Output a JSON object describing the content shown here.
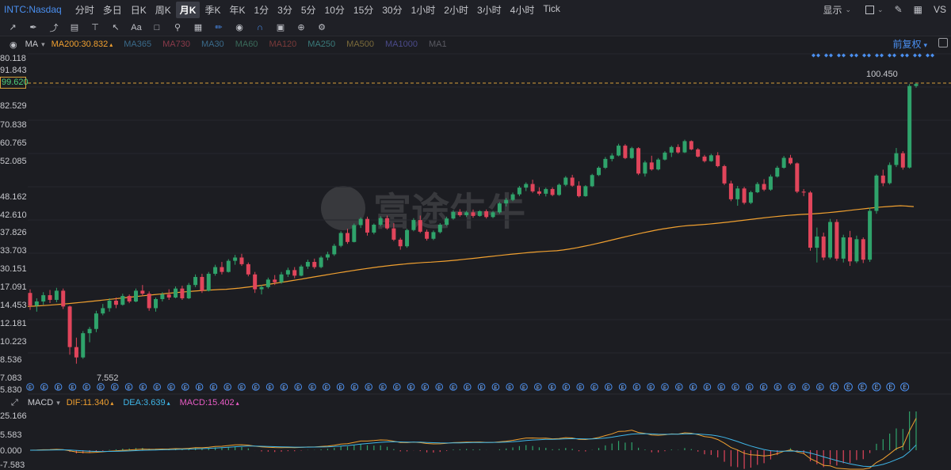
{
  "symbol": "INTC:Nasdaq",
  "periods": [
    "分时",
    "多日",
    "日K",
    "周K",
    "月K",
    "季K",
    "年K",
    "1分",
    "3分",
    "5分",
    "10分",
    "15分",
    "30分",
    "1小时",
    "2小时",
    "3小时",
    "4小时",
    "Tick"
  ],
  "active_period": "月K",
  "top_right": {
    "display": "显示",
    "logo": "VS"
  },
  "indicator": {
    "name": "MA",
    "ma200": "MA200:30.832",
    "dim_items": [
      "MA365",
      "MA730",
      "MA30",
      "MA60",
      "MA120",
      "MA250",
      "MA500",
      "MA1000",
      "MA1"
    ],
    "adjust": "前复权"
  },
  "y_axis_labels": [
    "80.118",
    "91.843",
    "99.620",
    "82.529",
    "70.838",
    "60.765",
    "52.085",
    "48.162",
    "42.610",
    "37.826",
    "33.703",
    "30.151",
    "17.091",
    "14.453",
    "12.181",
    "10.223",
    "8.536",
    "7.083",
    "5.830"
  ],
  "cursor_value": "99.620",
  "high_label": "100.450",
  "low_label": "7.552",
  "macd": {
    "name": "MACD",
    "dif": "DIF:11.340",
    "dea": "DEA:3.639",
    "macd": "MACD:15.402"
  },
  "macd_axis_labels": [
    "25.166",
    "5.583",
    "0.000",
    "-7.583"
  ],
  "watermark": "富途牛牛",
  "colors": {
    "up": "#2fa36b",
    "down": "#e1455b",
    "ma200": "#f0a030",
    "dif": "#f0a030",
    "dea": "#3fb6e8",
    "macd": "#e85bc5",
    "accent": "#4a8ff0"
  },
  "chart_data": {
    "type": "candlestick",
    "title": "INTC:Nasdaq",
    "ma_line": "MA200",
    "candles": [
      [
        14.5,
        15.0,
        12.4,
        12.9
      ],
      [
        12.9,
        13.8,
        12.2,
        13.4
      ],
      [
        13.4,
        14.6,
        13.0,
        14.2
      ],
      [
        14.2,
        14.9,
        13.2,
        13.6
      ],
      [
        13.6,
        15.2,
        13.3,
        14.8
      ],
      [
        14.8,
        15.1,
        12.5,
        12.8
      ],
      [
        12.8,
        12.9,
        8.2,
        8.8
      ],
      [
        8.8,
        9.6,
        7.55,
        8.0
      ],
      [
        8.0,
        10.2,
        7.9,
        10.0
      ],
      [
        10.0,
        10.6,
        9.2,
        10.4
      ],
      [
        10.4,
        12.3,
        10.1,
        12.0
      ],
      [
        12.0,
        13.1,
        11.8,
        12.6
      ],
      [
        12.6,
        13.8,
        12.2,
        13.5
      ],
      [
        13.5,
        13.9,
        12.6,
        13.0
      ],
      [
        13.0,
        14.4,
        12.9,
        14.1
      ],
      [
        14.1,
        14.3,
        13.2,
        13.4
      ],
      [
        13.4,
        15.1,
        13.3,
        14.8
      ],
      [
        14.8,
        15.6,
        14.1,
        14.4
      ],
      [
        14.4,
        14.7,
        12.3,
        12.6
      ],
      [
        12.6,
        13.9,
        12.2,
        13.7
      ],
      [
        13.7,
        14.6,
        13.4,
        14.3
      ],
      [
        14.3,
        15.0,
        13.6,
        13.9
      ],
      [
        13.9,
        15.4,
        13.8,
        15.1
      ],
      [
        15.1,
        15.5,
        13.6,
        13.8
      ],
      [
        13.8,
        15.9,
        13.7,
        15.6
      ],
      [
        15.6,
        17.2,
        15.3,
        16.8
      ],
      [
        16.8,
        17.3,
        14.5,
        14.8
      ],
      [
        14.8,
        17.6,
        14.7,
        17.3
      ],
      [
        17.3,
        18.8,
        17.0,
        18.4
      ],
      [
        18.4,
        19.3,
        17.2,
        17.6
      ],
      [
        17.6,
        19.8,
        17.5,
        19.5
      ],
      [
        19.5,
        20.6,
        18.8,
        20.1
      ],
      [
        20.1,
        20.8,
        18.6,
        18.9
      ],
      [
        18.9,
        19.2,
        16.9,
        17.2
      ],
      [
        17.2,
        17.6,
        14.5,
        15.0
      ],
      [
        15.0,
        15.6,
        14.3,
        15.3
      ],
      [
        15.3,
        16.7,
        15.1,
        16.4
      ],
      [
        16.4,
        17.1,
        15.6,
        16.0
      ],
      [
        16.0,
        17.6,
        15.8,
        17.2
      ],
      [
        17.2,
        18.3,
        16.8,
        17.9
      ],
      [
        17.9,
        18.4,
        16.6,
        17.0
      ],
      [
        17.0,
        18.8,
        16.9,
        18.5
      ],
      [
        18.5,
        19.7,
        18.1,
        19.3
      ],
      [
        19.3,
        19.9,
        18.1,
        18.4
      ],
      [
        18.4,
        20.4,
        18.2,
        20.1
      ],
      [
        20.1,
        21.2,
        19.6,
        20.7
      ],
      [
        20.7,
        22.8,
        20.4,
        22.4
      ],
      [
        22.4,
        25.6,
        22.1,
        25.2
      ],
      [
        25.2,
        26.2,
        22.8,
        23.2
      ],
      [
        23.2,
        27.5,
        23.1,
        27.1
      ],
      [
        27.1,
        29.1,
        26.4,
        28.7
      ],
      [
        28.7,
        29.3,
        24.6,
        25.3
      ],
      [
        25.3,
        27.5,
        24.9,
        27.2
      ],
      [
        27.2,
        29.4,
        26.8,
        28.9
      ],
      [
        28.9,
        29.6,
        26.0,
        26.3
      ],
      [
        26.3,
        27.6,
        23.4,
        23.7
      ],
      [
        23.7,
        24.1,
        21.6,
        22.3
      ],
      [
        22.3,
        26.2,
        22.0,
        25.9
      ],
      [
        25.9,
        28.9,
        25.6,
        28.4
      ],
      [
        28.4,
        29.6,
        25.2,
        25.5
      ],
      [
        25.5,
        26.0,
        23.5,
        23.9
      ],
      [
        23.9,
        25.8,
        23.6,
        25.4
      ],
      [
        25.4,
        27.6,
        25.1,
        27.2
      ],
      [
        27.2,
        29.3,
        26.9,
        28.8
      ],
      [
        28.8,
        31.1,
        28.5,
        30.6
      ],
      [
        30.6,
        31.4,
        29.3,
        29.7
      ],
      [
        29.7,
        30.9,
        29.2,
        30.5
      ],
      [
        30.5,
        31.3,
        29.0,
        29.5
      ],
      [
        29.5,
        31.1,
        29.3,
        30.8
      ],
      [
        30.8,
        31.3,
        28.8,
        29.2
      ],
      [
        29.2,
        30.9,
        28.9,
        30.5
      ],
      [
        30.5,
        33.5,
        30.1,
        33.1
      ],
      [
        33.1,
        34.8,
        32.2,
        34.2
      ],
      [
        34.2,
        36.6,
        33.8,
        36.0
      ],
      [
        36.0,
        38.9,
        35.4,
        38.3
      ],
      [
        38.3,
        40.2,
        37.1,
        39.6
      ],
      [
        39.6,
        41.2,
        36.5,
        37.0
      ],
      [
        37.0,
        38.4,
        35.6,
        36.2
      ],
      [
        36.2,
        38.3,
        35.3,
        37.8
      ],
      [
        37.8,
        38.4,
        35.4,
        35.8
      ],
      [
        35.8,
        39.8,
        35.5,
        39.3
      ],
      [
        39.3,
        42.6,
        38.8,
        42.0
      ],
      [
        42.0,
        43.1,
        38.6,
        39.0
      ],
      [
        39.0,
        40.6,
        35.0,
        35.4
      ],
      [
        35.4,
        39.2,
        35.2,
        38.8
      ],
      [
        38.8,
        43.5,
        38.5,
        43.0
      ],
      [
        43.0,
        46.6,
        42.6,
        46.0
      ],
      [
        46.0,
        50.8,
        45.5,
        49.9
      ],
      [
        49.9,
        52.6,
        48.8,
        51.5
      ],
      [
        51.5,
        57.4,
        51.1,
        56.4
      ],
      [
        56.4,
        57.2,
        49.8,
        50.3
      ],
      [
        50.3,
        55.8,
        49.9,
        55.1
      ],
      [
        55.1,
        55.6,
        43.0,
        43.6
      ],
      [
        43.6,
        49.1,
        42.4,
        48.3
      ],
      [
        48.3,
        51.4,
        44.8,
        45.3
      ],
      [
        45.3,
        50.3,
        44.9,
        49.6
      ],
      [
        49.6,
        53.6,
        49.2,
        52.9
      ],
      [
        52.9,
        56.4,
        50.8,
        55.7
      ],
      [
        55.7,
        57.1,
        52.4,
        53.0
      ],
      [
        53.0,
        59.6,
        52.7,
        58.8
      ],
      [
        58.8,
        59.2,
        54.1,
        54.5
      ],
      [
        54.5,
        55.1,
        50.6,
        51.0
      ],
      [
        51.0,
        51.8,
        48.3,
        48.9
      ],
      [
        48.9,
        52.3,
        48.6,
        51.6
      ],
      [
        51.6,
        53.1,
        46.2,
        46.7
      ],
      [
        46.7,
        47.3,
        39.2,
        39.8
      ],
      [
        39.8,
        40.8,
        33.8,
        34.4
      ],
      [
        34.4,
        38.9,
        32.4,
        38.0
      ],
      [
        38.0,
        38.6,
        32.8,
        33.3
      ],
      [
        33.3,
        37.2,
        32.9,
        36.7
      ],
      [
        36.7,
        40.3,
        36.4,
        39.6
      ],
      [
        39.6,
        41.4,
        37.1,
        37.6
      ],
      [
        37.6,
        43.2,
        37.2,
        42.4
      ],
      [
        42.4,
        46.8,
        42.0,
        46.0
      ],
      [
        46.0,
        51.3,
        45.6,
        50.4
      ],
      [
        50.4,
        51.8,
        47.3,
        47.9
      ],
      [
        47.9,
        48.3,
        36.4,
        36.9
      ],
      [
        36.9,
        37.8,
        35.4,
        36.6
      ],
      [
        36.6,
        37.1,
        21.4,
        22.0
      ],
      [
        22.0,
        26.5,
        19.2,
        24.4
      ],
      [
        24.4,
        25.3,
        19.6,
        20.1
      ],
      [
        20.1,
        28.7,
        19.8,
        27.9
      ],
      [
        27.9,
        28.6,
        19.5,
        19.9
      ],
      [
        19.9,
        24.8,
        19.2,
        24.2
      ],
      [
        24.2,
        25.7,
        18.6,
        19.4
      ],
      [
        19.4,
        24.6,
        19.1,
        23.8
      ],
      [
        23.8,
        24.2,
        19.1,
        19.7
      ],
      [
        19.7,
        31.8,
        19.3,
        30.9
      ],
      [
        30.9,
        43.3,
        30.1,
        42.8
      ],
      [
        42.8,
        45.2,
        38.8,
        39.9
      ],
      [
        39.9,
        48.3,
        39.4,
        47.2
      ],
      [
        47.2,
        55.2,
        46.3,
        52.6
      ],
      [
        52.6,
        53.6,
        45.2,
        46.1
      ],
      [
        46.1,
        99.6,
        45.7,
        97.8
      ],
      [
        97.8,
        100.45,
        96.2,
        99.62
      ]
    ],
    "ma200_anchor_points": [
      [
        0,
        12.8
      ],
      [
        30,
        15.0
      ],
      [
        60,
        19.2
      ],
      [
        80,
        21.4
      ],
      [
        100,
        27.0
      ],
      [
        118,
        30.0
      ],
      [
        132,
        32.4
      ],
      [
        142,
        30.832
      ]
    ]
  }
}
